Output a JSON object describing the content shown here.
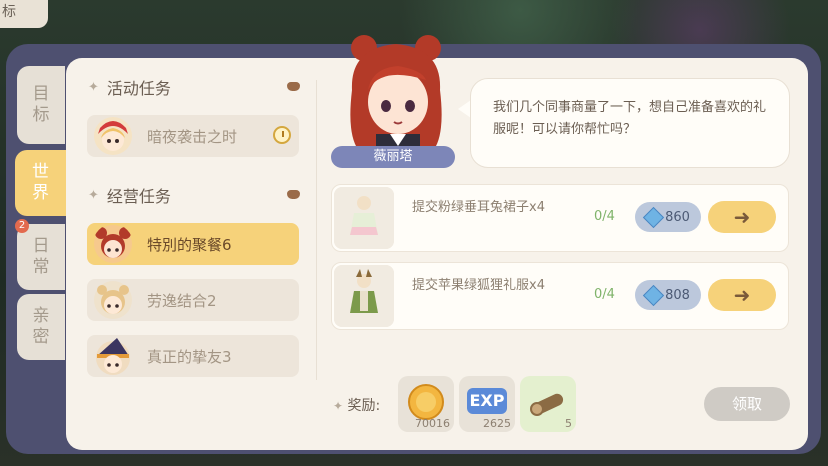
{
  "top_chip": "标",
  "side_tabs": [
    {
      "label": "目\n标"
    },
    {
      "label": "世\n界"
    },
    {
      "label": "日\n常",
      "badge": "2"
    },
    {
      "label": "亲\n密"
    }
  ],
  "sections": [
    {
      "title": "活动任务",
      "tasks": [
        {
          "label": "暗夜袭击之时"
        }
      ]
    },
    {
      "title": "经营任务",
      "tasks": [
        {
          "label": "特別的聚餐6"
        },
        {
          "label": "劳逸结合2"
        },
        {
          "label": "真正的挚友3"
        }
      ]
    }
  ],
  "character": {
    "name": "薇丽塔"
  },
  "speech": "我们几个同事商量了一下，想自己准备喜欢的礼服呢！可以请你帮忙吗？",
  "requirements": [
    {
      "desc": "提交粉绿垂耳兔裙子x4",
      "count": "0/4",
      "price": "860"
    },
    {
      "desc": "提交苹果绿狐狸礼服x4",
      "count": "0/4",
      "price": "808"
    }
  ],
  "rewards": {
    "label": "奖励:",
    "items": [
      {
        "icon": "gold-coin-icon",
        "amount": "70016"
      },
      {
        "icon": "exp-icon",
        "text": "EXP",
        "amount": "2625"
      },
      {
        "icon": "wood-log-icon",
        "amount": "5"
      }
    ]
  },
  "claim_button": "领取",
  "colors": {
    "accent": "#f6d27a",
    "frame": "#4e5070",
    "panel": "#f7f2ea"
  }
}
